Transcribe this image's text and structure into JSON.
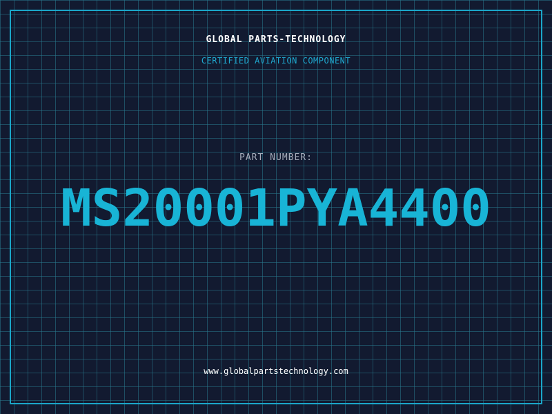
{
  "header": {
    "company": "GLOBAL PARTS-TECHNOLOGY",
    "tagline": "CERTIFIED AVIATION COMPONENT"
  },
  "main": {
    "label": "PART NUMBER:",
    "part_number": "MS20001PYA4400"
  },
  "footer": {
    "website": "www.globalpartstechnology.com"
  },
  "colors": {
    "background": "#121a30",
    "grid": "#28788c",
    "accent": "#18b4d6",
    "frame": "#1aa7c9",
    "text": "#ffffff"
  }
}
